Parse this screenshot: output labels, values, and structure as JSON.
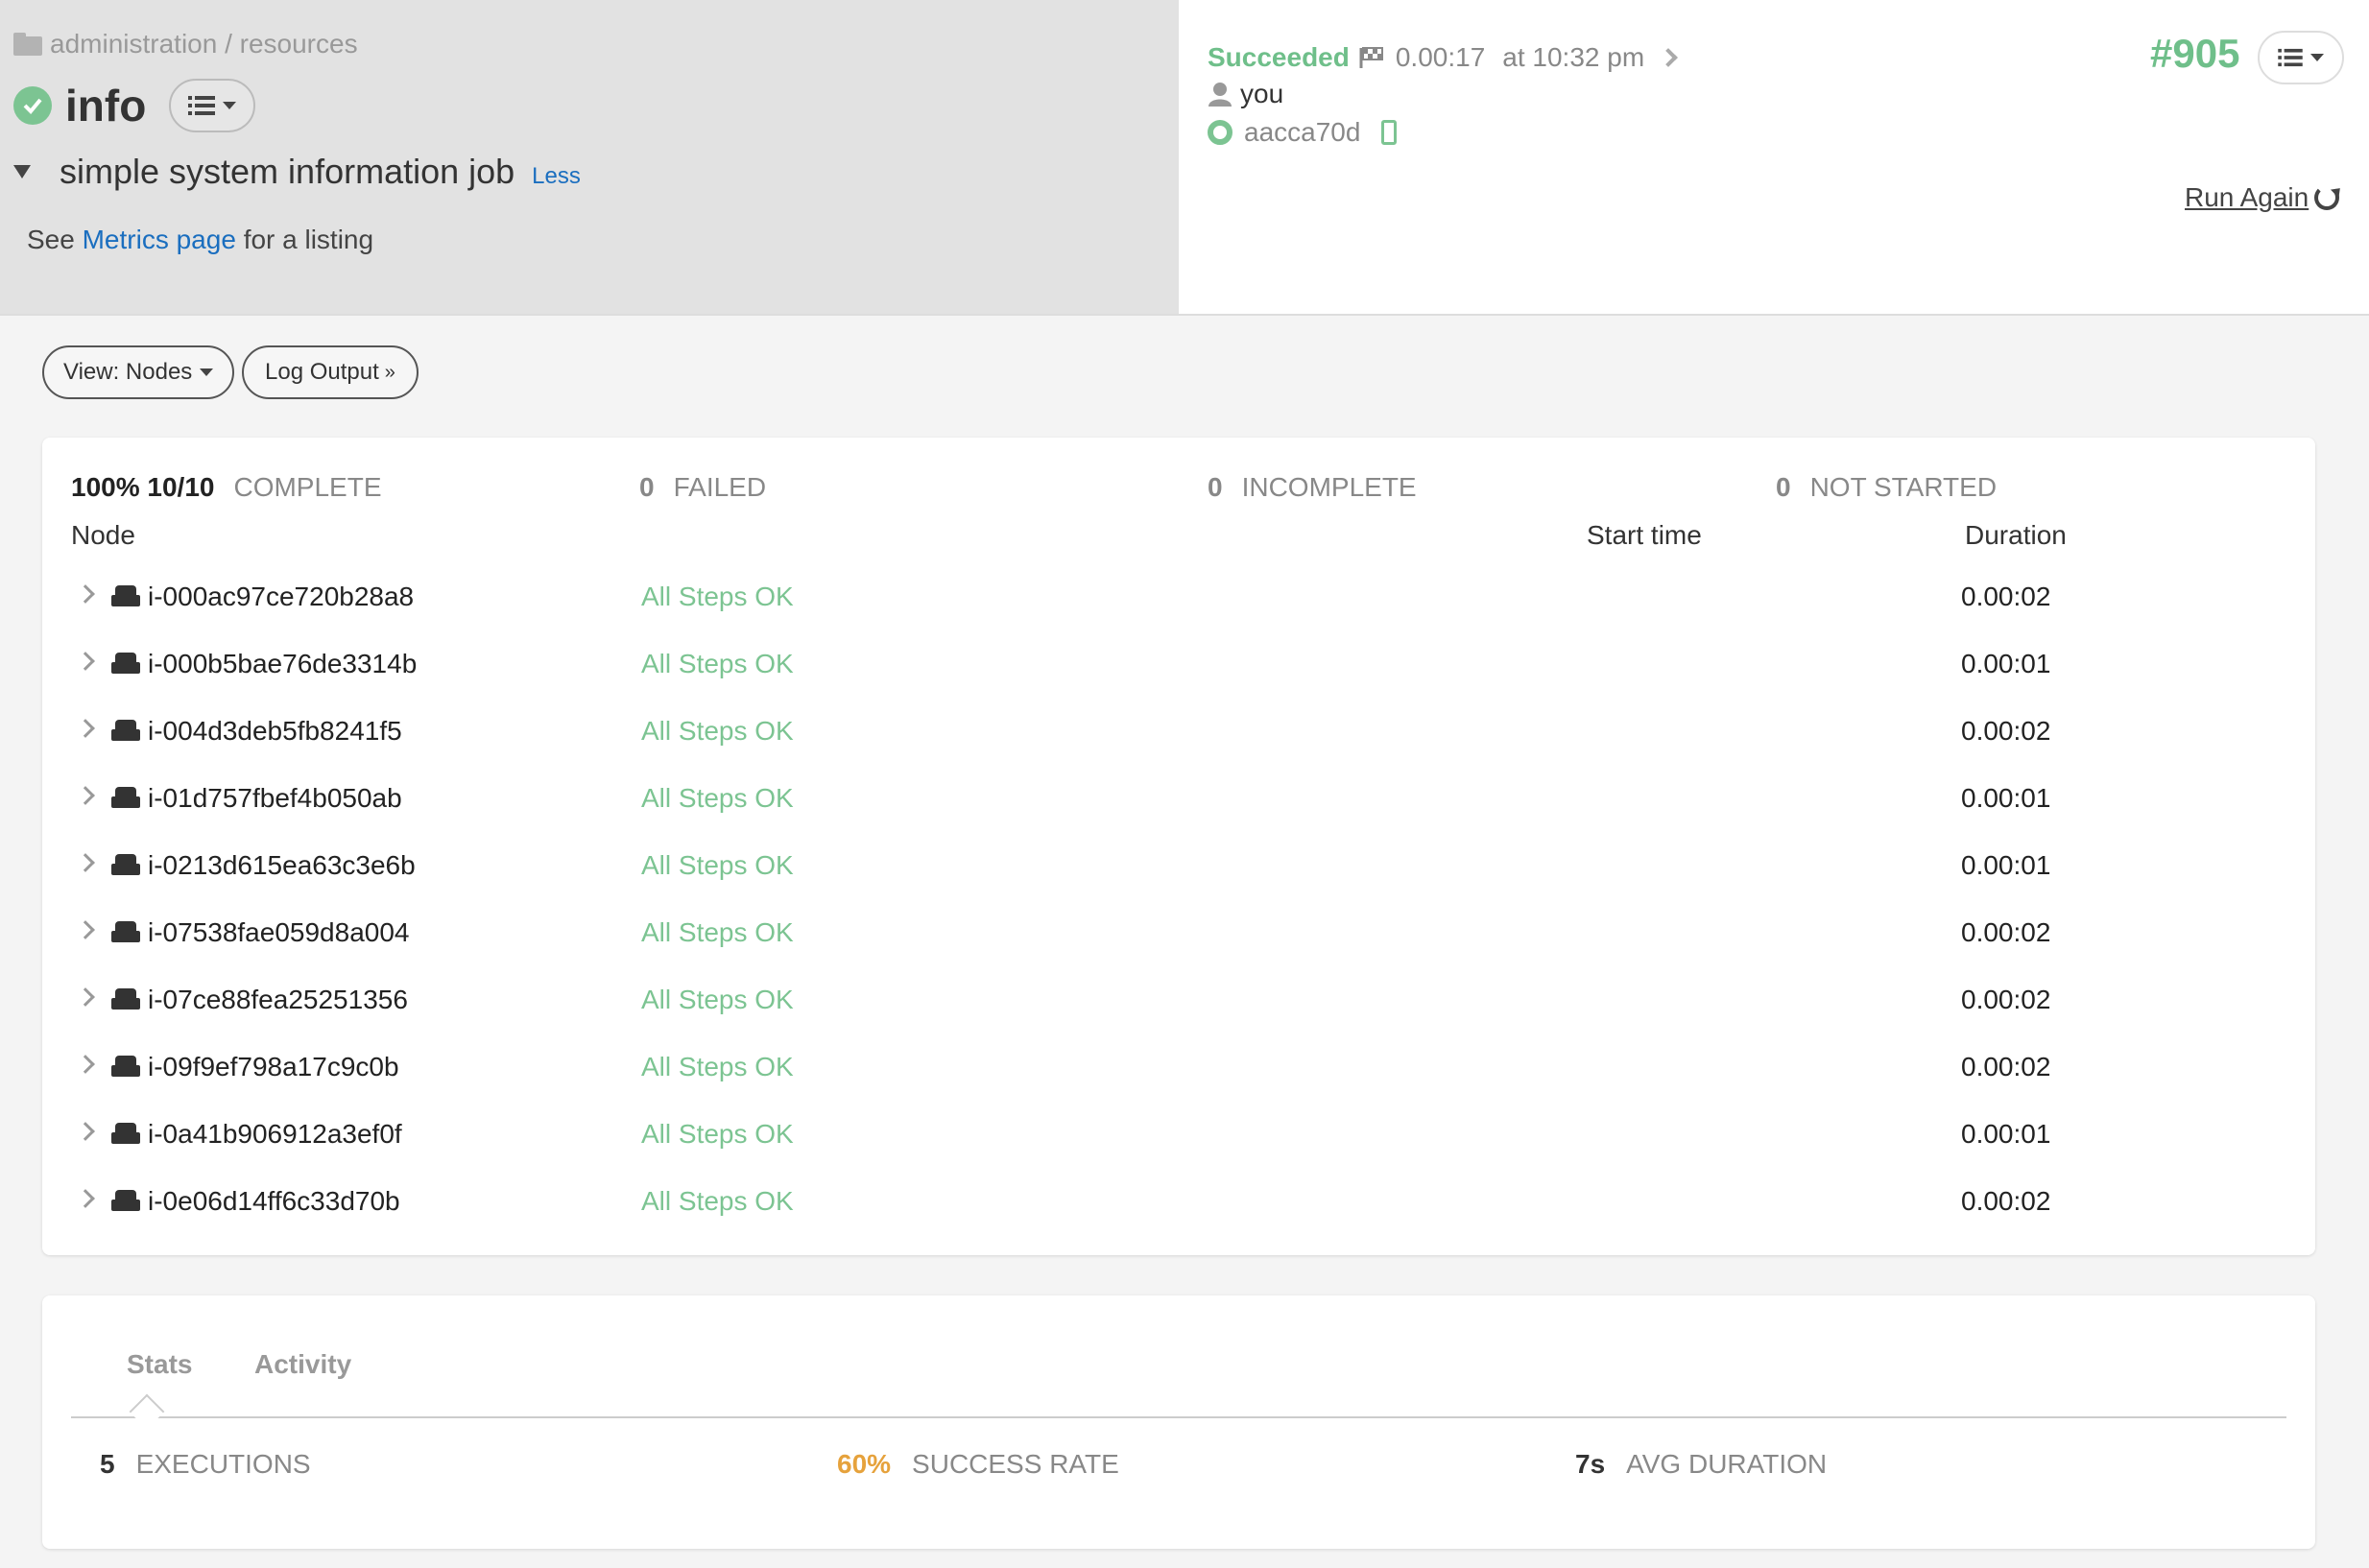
{
  "header": {
    "breadcrumb": "administration / resources",
    "job_name": "info",
    "description": "simple system information job",
    "less_link": "Less",
    "listing": {
      "prefix": "See",
      "link": "Metrics page",
      "suffix": "for a listing"
    }
  },
  "execution": {
    "status": "Succeeded",
    "duration": "0.00:17",
    "time": "at 10:32 pm",
    "user": "you",
    "commit": "aacca70d",
    "number": "#905",
    "run_again": "Run Again"
  },
  "toolbar": {
    "view_label": "View: Nodes",
    "log_label": "Log Output",
    "log_suffix": "»"
  },
  "summary": {
    "complete_value": "100% 10/10",
    "complete_label": "COMPLETE",
    "failed_value": "0",
    "failed_label": "FAILED",
    "incomplete_value": "0",
    "incomplete_label": "INCOMPLETE",
    "not_started_value": "0",
    "not_started_label": "NOT STARTED"
  },
  "table": {
    "headers": {
      "node": "Node",
      "start_time": "Start time",
      "duration": "Duration"
    },
    "rows": [
      {
        "node": "i-000ac97ce720b28a8",
        "status": "All Steps OK",
        "duration": "0.00:02"
      },
      {
        "node": "i-000b5bae76de3314b",
        "status": "All Steps OK",
        "duration": "0.00:01"
      },
      {
        "node": "i-004d3deb5fb8241f5",
        "status": "All Steps OK",
        "duration": "0.00:02"
      },
      {
        "node": "i-01d757fbef4b050ab",
        "status": "All Steps OK",
        "duration": "0.00:01"
      },
      {
        "node": "i-0213d615ea63c3e6b",
        "status": "All Steps OK",
        "duration": "0.00:01"
      },
      {
        "node": "i-07538fae059d8a004",
        "status": "All Steps OK",
        "duration": "0.00:02"
      },
      {
        "node": "i-07ce88fea25251356",
        "status": "All Steps OK",
        "duration": "0.00:02"
      },
      {
        "node": "i-09f9ef798a17c9c0b",
        "status": "All Steps OK",
        "duration": "0.00:02"
      },
      {
        "node": "i-0a41b906912a3ef0f",
        "status": "All Steps OK",
        "duration": "0.00:01"
      },
      {
        "node": "i-0e06d14ff6c33d70b",
        "status": "All Steps OK",
        "duration": "0.00:02"
      }
    ]
  },
  "stats": {
    "tabs": [
      "Stats",
      "Activity"
    ],
    "executions_value": "5",
    "executions_label": "EXECUTIONS",
    "success_rate_value": "60%",
    "success_rate_label": "SUCCESS RATE",
    "avg_duration_value": "7s",
    "avg_duration_label": "AVG DURATION"
  },
  "colors": {
    "success": "#7cc492",
    "link": "#1a6ebf",
    "warning": "#e6a23c"
  }
}
